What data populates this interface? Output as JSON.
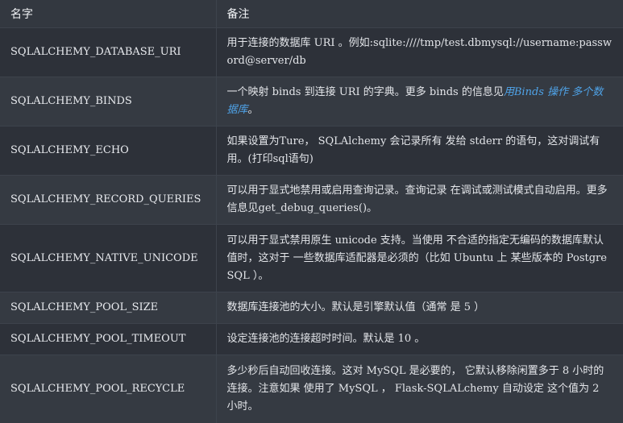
{
  "header": {
    "name": "名字",
    "note": "备注"
  },
  "rows": [
    {
      "name": "SQLALCHEMY_DATABASE_URI",
      "note": "用于连接的数据库 URI 。例如:sqlite:////tmp/test.dbmysql://username:password@server/db"
    },
    {
      "name": "SQLALCHEMY_BINDS",
      "note_before": "一个映射 binds 到连接 URI 的字典。更多 binds 的信息见",
      "note_link": "用Binds 操作 多个数据库",
      "note_after": "。"
    },
    {
      "name": "SQLALCHEMY_ECHO",
      "note": "如果设置为Ture， SQLAlchemy 会记录所有 发给 stderr 的语句，这对调试有用。(打印sql语句)"
    },
    {
      "name": "SQLALCHEMY_RECORD_QUERIES",
      "note": "可以用于显式地禁用或启用查询记录。查询记录 在调试或测试模式自动启用。更多信息见get_debug_queries()。"
    },
    {
      "name": "SQLALCHEMY_NATIVE_UNICODE",
      "note": "可以用于显式禁用原生 unicode 支持。当使用 不合适的指定无编码的数据库默认值时，这对于 一些数据库适配器是必须的（比如 Ubuntu 上 某些版本的 PostgreSQL ）。"
    },
    {
      "name": "SQLALCHEMY_POOL_SIZE",
      "note": "数据库连接池的大小。默认是引擎默认值（通常 是 5 ）"
    },
    {
      "name": "SQLALCHEMY_POOL_TIMEOUT",
      "note": "设定连接池的连接超时时间。默认是 10 。"
    },
    {
      "name": "SQLALCHEMY_POOL_RECYCLE",
      "note": "多少秒后自动回收连接。这对 MySQL 是必要的， 它默认移除闲置多于 8 小时的连接。注意如果 使用了 MySQL ， Flask-SQLALchemy 自动设定 这个值为 2 小时。"
    }
  ]
}
